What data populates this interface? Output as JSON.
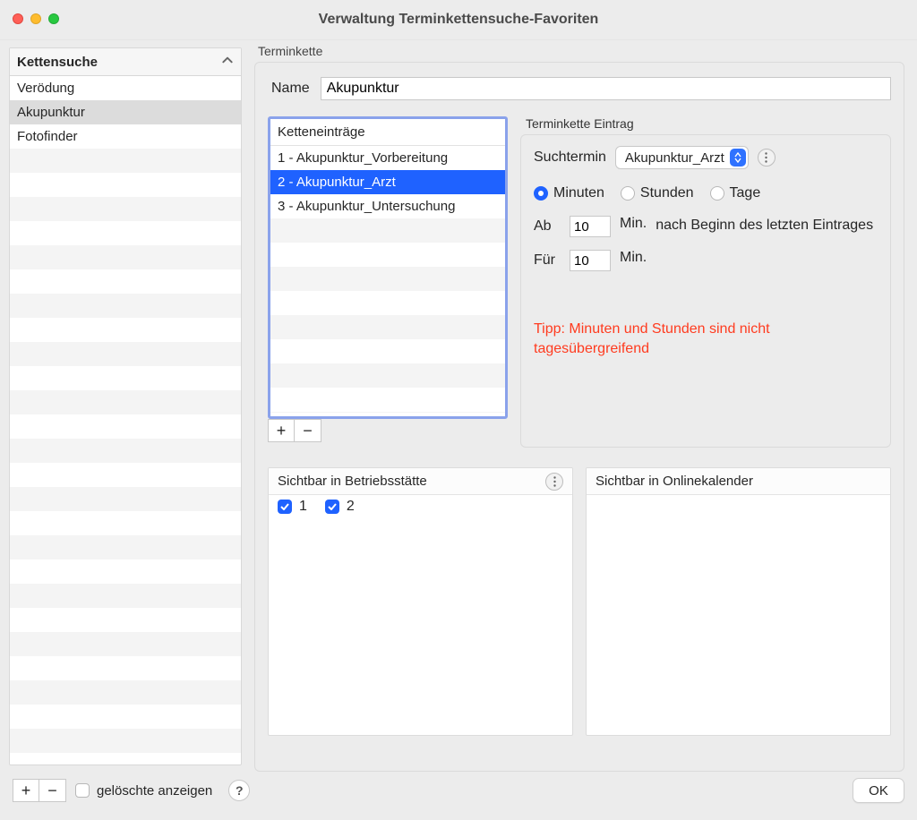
{
  "window": {
    "title": "Verwaltung Terminkettensuche-Favoriten"
  },
  "sidebar": {
    "section_header": "Kettensuche",
    "items": [
      {
        "label": "Verödung",
        "selected": false
      },
      {
        "label": "Akupunktur",
        "selected": true
      },
      {
        "label": "Fotofinder",
        "selected": false
      }
    ]
  },
  "main": {
    "group_label": "Terminkette",
    "name_label": "Name",
    "name_value": "Akupunktur",
    "entries": {
      "header": "Ketteneinträge",
      "items": [
        {
          "label": "1 - Akupunktur_Vorbereitung",
          "selected": false
        },
        {
          "label": "2 - Akupunktur_Arzt",
          "selected": true
        },
        {
          "label": "3 - Akupunktur_Untersuchung",
          "selected": false
        }
      ]
    },
    "detail": {
      "group_label": "Terminkette Eintrag",
      "search_label": "Suchtermin",
      "search_value": "Akupunktur_Arzt",
      "unit_options": {
        "minutes": "Minuten",
        "hours": "Stunden",
        "days": "Tage",
        "selected": "minutes"
      },
      "from_label": "Ab",
      "from_value": "10",
      "from_unit": "Min.",
      "from_desc": "nach Beginn des letzten Eintrages",
      "duration_label": "Für",
      "duration_value": "10",
      "duration_unit": "Min.",
      "tip": "Tipp: Minuten und Stunden sind nicht tagesübergreifend"
    },
    "visibility": {
      "site_header": "Sichtbar in Betriebsstätte",
      "online_header": "Sichtbar in Onlinekalender",
      "site_items": [
        {
          "label": "1",
          "checked": true
        },
        {
          "label": "2",
          "checked": true
        }
      ]
    }
  },
  "footer": {
    "show_deleted_label": "gelöschte anzeigen",
    "show_deleted_checked": false,
    "ok_label": "OK",
    "help_label": "?"
  },
  "icons": {
    "add": "+",
    "remove": "−"
  }
}
